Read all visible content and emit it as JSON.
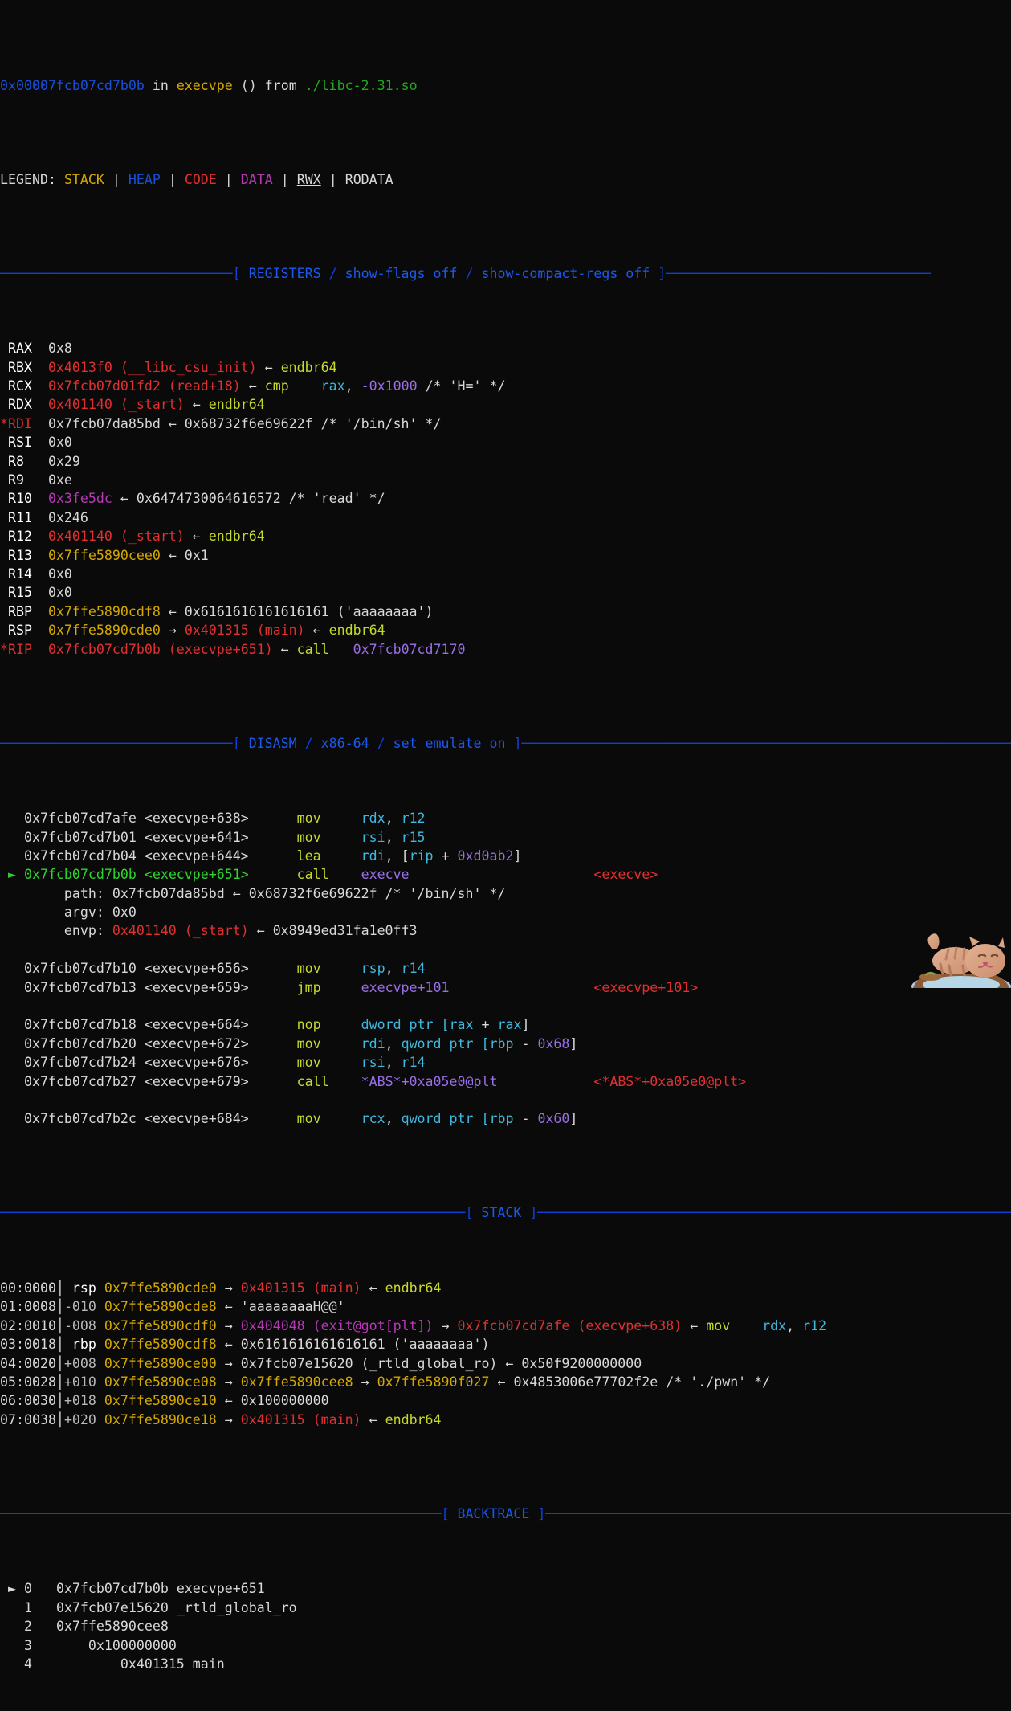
{
  "terminal": {
    "background": "#0a0a0a",
    "foreground": "#d8d8d8",
    "program": "pwndbg",
    "cols": 130,
    "rows": 52
  },
  "colors": {
    "stack": "#d4a800",
    "heap": "#1a4fd8",
    "code": "#e03030",
    "data": "#b838b8",
    "rodata": "#d8d8d8",
    "banner": "#1040d8",
    "current": "#2fd22f",
    "mnemonic": "#c6d92a",
    "register_operand": "#3fb8e0",
    "immediate": "#9a6ee8",
    "filename": "#23a723"
  },
  "header": {
    "address": "0x00007fcb07cd7b0b",
    "in_word": "in",
    "function": "execvpe",
    "parens": "()",
    "from_word": "from",
    "library": "./libc-2.31.so"
  },
  "legend": {
    "label": "LEGEND:",
    "items": [
      "STACK",
      "HEAP",
      "CODE",
      "DATA",
      "RWX",
      "RODATA"
    ],
    "separator": "|"
  },
  "banners": {
    "registers": "[ REGISTERS / show-flags off / show-compact-regs off ]",
    "registers_parts": {
      "open": "[",
      "name": "REGISTERS",
      "slash": "/",
      "opt1": "show-flags off",
      "opt2": "show-compact-regs off",
      "close": "]"
    },
    "disasm": "[ DISASM / x86-64 / set emulate on ]",
    "disasm_parts": {
      "open": "[",
      "name": "DISASM",
      "arch": "x86-64",
      "opt": "set emulate on",
      "close": "]"
    },
    "stack": "[ STACK ]",
    "stack_name": "STACK",
    "backtrace": "[ BACKTRACE ]",
    "backtrace_name": "BACKTRACE"
  },
  "registers": [
    {
      "marker": "",
      "name": "RAX",
      "value": "0x8",
      "value_class": "c-white",
      "rest": []
    },
    {
      "marker": "",
      "name": "RBX",
      "value": "0x4013f0 (__libc_csu_init)",
      "value_class": "c-code",
      "rest": [
        {
          "t": " ← ",
          "c": "c-white"
        },
        {
          "t": "endbr64",
          "c": "c-endbr"
        }
      ]
    },
    {
      "marker": "",
      "name": "RCX",
      "value": "0x7fcb07d01fd2 (read+18)",
      "value_class": "c-code",
      "rest": [
        {
          "t": " ← ",
          "c": "c-white"
        },
        {
          "t": "cmp",
          "c": "c-mnem"
        },
        {
          "t": "    ",
          "c": "c-white"
        },
        {
          "t": "rax",
          "c": "c-reg"
        },
        {
          "t": ", ",
          "c": "c-white"
        },
        {
          "t": "-0x1000",
          "c": "c-imm"
        },
        {
          "t": " /* 'H=' */",
          "c": "c-white"
        }
      ]
    },
    {
      "marker": "",
      "name": "RDX",
      "value": "0x401140 (_start)",
      "value_class": "c-code",
      "rest": [
        {
          "t": " ← ",
          "c": "c-white"
        },
        {
          "t": "endbr64",
          "c": "c-endbr"
        }
      ]
    },
    {
      "marker": "*",
      "name": "RDI",
      "value": "0x7fcb07da85bd",
      "value_class": "c-white",
      "rest": [
        {
          "t": " ← 0x68732f6e69622f /* '/bin/sh' */",
          "c": "c-white"
        }
      ]
    },
    {
      "marker": "",
      "name": "RSI",
      "value": "0x0",
      "value_class": "c-white",
      "rest": []
    },
    {
      "marker": "",
      "name": "R8",
      "value": "0x29",
      "value_class": "c-white",
      "rest": []
    },
    {
      "marker": "",
      "name": "R9",
      "value": "0xe",
      "value_class": "c-white",
      "rest": []
    },
    {
      "marker": "",
      "name": "R10",
      "value": "0x3fe5dc",
      "value_class": "c-data",
      "rest": [
        {
          "t": " ← 0x6474730064616572 /* 'read' */",
          "c": "c-white"
        }
      ]
    },
    {
      "marker": "",
      "name": "R11",
      "value": "0x246",
      "value_class": "c-white",
      "rest": []
    },
    {
      "marker": "",
      "name": "R12",
      "value": "0x401140 (_start)",
      "value_class": "c-code",
      "rest": [
        {
          "t": " ← ",
          "c": "c-white"
        },
        {
          "t": "endbr64",
          "c": "c-endbr"
        }
      ]
    },
    {
      "marker": "",
      "name": "R13",
      "value": "0x7ffe5890cee0",
      "value_class": "c-stack",
      "rest": [
        {
          "t": " ← 0x1",
          "c": "c-white"
        }
      ]
    },
    {
      "marker": "",
      "name": "R14",
      "value": "0x0",
      "value_class": "c-white",
      "rest": []
    },
    {
      "marker": "",
      "name": "R15",
      "value": "0x0",
      "value_class": "c-white",
      "rest": []
    },
    {
      "marker": "",
      "name": "RBP",
      "value": "0x7ffe5890cdf8",
      "value_class": "c-stack",
      "rest": [
        {
          "t": " ← 0x6161616161616161 ('aaaaaaaa')",
          "c": "c-white"
        }
      ]
    },
    {
      "marker": "",
      "name": "RSP",
      "value": "0x7ffe5890cde0",
      "value_class": "c-stack",
      "rest": [
        {
          "t": " → ",
          "c": "c-white"
        },
        {
          "t": "0x401315 (main)",
          "c": "c-code"
        },
        {
          "t": " ← ",
          "c": "c-white"
        },
        {
          "t": "endbr64",
          "c": "c-endbr"
        }
      ]
    },
    {
      "marker": "*",
      "name": "RIP",
      "value": "0x7fcb07cd7b0b (execvpe+651)",
      "value_class": "c-code",
      "rest": [
        {
          "t": " ← ",
          "c": "c-white"
        },
        {
          "t": "call",
          "c": "c-mnem"
        },
        {
          "t": "   ",
          "c": "c-white"
        },
        {
          "t": "0x7fcb07cd7170",
          "c": "c-imm"
        }
      ]
    }
  ],
  "disasm": [
    {
      "current": false,
      "blank": false,
      "addr": "0x7fcb07cd7afe",
      "sym": "<execvpe+638>",
      "mnem": "mov",
      "ops": [
        {
          "t": "rdx",
          "c": "c-reg"
        },
        {
          "t": ", ",
          "c": "c-white"
        },
        {
          "t": "r12",
          "c": "c-reg"
        }
      ],
      "target": ""
    },
    {
      "current": false,
      "blank": false,
      "addr": "0x7fcb07cd7b01",
      "sym": "<execvpe+641>",
      "mnem": "mov",
      "ops": [
        {
          "t": "rsi",
          "c": "c-reg"
        },
        {
          "t": ", ",
          "c": "c-white"
        },
        {
          "t": "r15",
          "c": "c-reg"
        }
      ],
      "target": ""
    },
    {
      "current": false,
      "blank": false,
      "addr": "0x7fcb07cd7b04",
      "sym": "<execvpe+644>",
      "mnem": "lea",
      "ops": [
        {
          "t": "rdi",
          "c": "c-reg"
        },
        {
          "t": ", [",
          "c": "c-white"
        },
        {
          "t": "rip",
          "c": "c-reg"
        },
        {
          "t": " + ",
          "c": "c-white"
        },
        {
          "t": "0xd0ab2",
          "c": "c-imm"
        },
        {
          "t": "]",
          "c": "c-white"
        }
      ],
      "target": ""
    },
    {
      "current": true,
      "blank": false,
      "addr": "0x7fcb07cd7b0b",
      "sym": "<execvpe+651>",
      "mnem": "call",
      "ops": [
        {
          "t": "execve",
          "c": "c-imm"
        }
      ],
      "target": "<execve>",
      "target_class": "c-code"
    },
    {
      "args": [
        {
          "label": "path:",
          "value": "0x7fcb07da85bd",
          "value_class": "c-white",
          "rest": " ← 0x68732f6e69622f /* '/bin/sh' */"
        },
        {
          "label": "argv:",
          "value": "0x0",
          "value_class": "c-white",
          "rest": ""
        },
        {
          "label": "envp:",
          "value": "0x401140 (_start)",
          "value_class": "c-code",
          "rest": " ← 0x8949ed31fa1e0ff3"
        }
      ]
    },
    {
      "spacer": true
    },
    {
      "current": false,
      "blank": false,
      "addr": "0x7fcb07cd7b10",
      "sym": "<execvpe+656>",
      "mnem": "mov",
      "ops": [
        {
          "t": "rsp",
          "c": "c-reg"
        },
        {
          "t": ", ",
          "c": "c-white"
        },
        {
          "t": "r14",
          "c": "c-reg"
        }
      ],
      "target": ""
    },
    {
      "current": false,
      "blank": false,
      "addr": "0x7fcb07cd7b13",
      "sym": "<execvpe+659>",
      "mnem": "jmp",
      "ops": [
        {
          "t": "execvpe+101",
          "c": "c-imm"
        }
      ],
      "target": "<execvpe+101>",
      "target_class": "c-code"
    },
    {
      "spacer": true
    },
    {
      "current": false,
      "blank": false,
      "addr": "0x7fcb07cd7b18",
      "sym": "<execvpe+664>",
      "mnem": "nop",
      "ops": [
        {
          "t": "dword ptr [",
          "c": "c-reg"
        },
        {
          "t": "rax",
          "c": "c-reg"
        },
        {
          "t": " + ",
          "c": "c-white"
        },
        {
          "t": "rax",
          "c": "c-reg"
        },
        {
          "t": "]",
          "c": "c-white"
        }
      ],
      "target": ""
    },
    {
      "current": false,
      "blank": false,
      "addr": "0x7fcb07cd7b20",
      "sym": "<execvpe+672>",
      "mnem": "mov",
      "ops": [
        {
          "t": "rdi",
          "c": "c-reg"
        },
        {
          "t": ", ",
          "c": "c-white"
        },
        {
          "t": "qword ptr [",
          "c": "c-reg"
        },
        {
          "t": "rbp",
          "c": "c-reg"
        },
        {
          "t": " - ",
          "c": "c-white"
        },
        {
          "t": "0x68",
          "c": "c-imm"
        },
        {
          "t": "]",
          "c": "c-white"
        }
      ],
      "target": ""
    },
    {
      "current": false,
      "blank": false,
      "addr": "0x7fcb07cd7b24",
      "sym": "<execvpe+676>",
      "mnem": "mov",
      "ops": [
        {
          "t": "rsi",
          "c": "c-reg"
        },
        {
          "t": ", ",
          "c": "c-white"
        },
        {
          "t": "r14",
          "c": "c-reg"
        }
      ],
      "target": ""
    },
    {
      "current": false,
      "blank": false,
      "addr": "0x7fcb07cd7b27",
      "sym": "<execvpe+679>",
      "mnem": "call",
      "ops": [
        {
          "t": "*ABS*+0xa05e0@plt",
          "c": "c-imm"
        }
      ],
      "target": "<*ABS*+0xa05e0@plt>",
      "target_class": "c-code"
    },
    {
      "spacer": true
    },
    {
      "current": false,
      "blank": false,
      "addr": "0x7fcb07cd7b2c",
      "sym": "<execvpe+684>",
      "mnem": "mov",
      "ops": [
        {
          "t": "rcx",
          "c": "c-reg"
        },
        {
          "t": ", ",
          "c": "c-white"
        },
        {
          "t": "qword ptr [",
          "c": "c-reg"
        },
        {
          "t": "rbp",
          "c": "c-reg"
        },
        {
          "t": " - ",
          "c": "c-white"
        },
        {
          "t": "0x60",
          "c": "c-imm"
        },
        {
          "t": "]",
          "c": "c-white"
        }
      ],
      "target": ""
    }
  ],
  "stack": [
    {
      "index": "00:0000",
      "off": " rsp",
      "off_class": "c-bwhite",
      "addr": "0x7ffe5890cde0",
      "addr_class": "c-stack",
      "rest": [
        {
          "t": " → ",
          "c": "c-white"
        },
        {
          "t": "0x401315 (main)",
          "c": "c-code"
        },
        {
          "t": " ← ",
          "c": "c-white"
        },
        {
          "t": "endbr64",
          "c": "c-endbr"
        }
      ]
    },
    {
      "index": "01:0008",
      "off": "-010",
      "off_class": "c-dim",
      "addr": "0x7ffe5890cde8",
      "addr_class": "c-stack",
      "rest": [
        {
          "t": " ← 'aaaaaaaaH@@'",
          "c": "c-white"
        }
      ]
    },
    {
      "index": "02:0010",
      "off": "-008",
      "off_class": "c-dim",
      "addr": "0x7ffe5890cdf0",
      "addr_class": "c-stack",
      "rest": [
        {
          "t": " → ",
          "c": "c-white"
        },
        {
          "t": "0x404048 (exit@got[plt])",
          "c": "c-data"
        },
        {
          "t": " → ",
          "c": "c-white"
        },
        {
          "t": "0x7fcb07cd7afe (execvpe+638)",
          "c": "c-code"
        },
        {
          "t": " ← ",
          "c": "c-white"
        },
        {
          "t": "mov",
          "c": "c-mnem"
        },
        {
          "t": "    ",
          "c": "c-white"
        },
        {
          "t": "rdx",
          "c": "c-reg"
        },
        {
          "t": ", ",
          "c": "c-white"
        },
        {
          "t": "r12",
          "c": "c-reg"
        }
      ]
    },
    {
      "index": "03:0018",
      "off": " rbp",
      "off_class": "c-bwhite",
      "addr": "0x7ffe5890cdf8",
      "addr_class": "c-stack",
      "rest": [
        {
          "t": " ← 0x6161616161616161 ('aaaaaaaa')",
          "c": "c-white"
        }
      ]
    },
    {
      "index": "04:0020",
      "off": "+008",
      "off_class": "c-dim",
      "addr": "0x7ffe5890ce00",
      "addr_class": "c-stack",
      "rest": [
        {
          "t": " → 0x7fcb07e15620 (_rtld_global_ro) ← 0x50f9200000000",
          "c": "c-white"
        }
      ]
    },
    {
      "index": "05:0028",
      "off": "+010",
      "off_class": "c-dim",
      "addr": "0x7ffe5890ce08",
      "addr_class": "c-stack",
      "rest": [
        {
          "t": " → ",
          "c": "c-white"
        },
        {
          "t": "0x7ffe5890cee8",
          "c": "c-stack"
        },
        {
          "t": " → ",
          "c": "c-white"
        },
        {
          "t": "0x7ffe5890f027",
          "c": "c-stack"
        },
        {
          "t": " ← 0x4853006e77702f2e /* './pwn' */",
          "c": "c-white"
        }
      ]
    },
    {
      "index": "06:0030",
      "off": "+018",
      "off_class": "c-dim",
      "addr": "0x7ffe5890ce10",
      "addr_class": "c-stack",
      "rest": [
        {
          "t": " ← 0x100000000",
          "c": "c-white"
        }
      ]
    },
    {
      "index": "07:0038",
      "off": "+020",
      "off_class": "c-dim",
      "addr": "0x7ffe5890ce18",
      "addr_class": "c-stack",
      "rest": [
        {
          "t": " → ",
          "c": "c-white"
        },
        {
          "t": "0x401315 (main)",
          "c": "c-code"
        },
        {
          "t": " ← ",
          "c": "c-white"
        },
        {
          "t": "endbr64",
          "c": "c-endbr"
        }
      ]
    }
  ],
  "backtrace": [
    {
      "current": true,
      "num": "0",
      "indent": 0,
      "addr": "0x7fcb07cd7b0b",
      "sym": "execvpe+651"
    },
    {
      "current": false,
      "num": "1",
      "indent": 0,
      "addr": "0x7fcb07e15620",
      "sym": "_rtld_global_ro"
    },
    {
      "current": false,
      "num": "2",
      "indent": 0,
      "addr": "0x7ffe5890cee8",
      "sym": ""
    },
    {
      "current": false,
      "num": "3",
      "indent": 2,
      "addr": "0x100000000",
      "sym": ""
    },
    {
      "current": false,
      "num": "4",
      "indent": 4,
      "addr": "0x401315",
      "sym": "main"
    }
  ],
  "decoration": {
    "cat_image": "cat-sprite"
  }
}
